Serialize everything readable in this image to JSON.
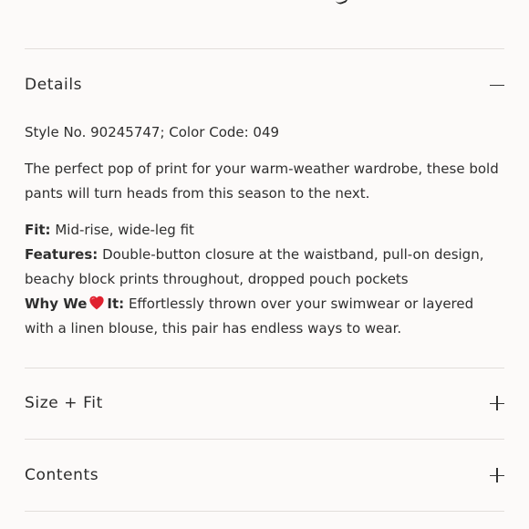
{
  "details": {
    "title": "Details",
    "style_line": "Style No. 90245747; Color Code: 049",
    "description": "The perfect pop of print for your warm-weather wardrobe, these bold pants will turn heads from this season to the next.",
    "fit_label": "Fit:",
    "fit_value": "Mid-rise, wide-leg fit",
    "features_label": "Features:",
    "features_value": "Double-button closure at the waistband, pull-on design, beachy block prints throughout, dropped pouch pockets",
    "why_label_start": "Why We",
    "why_label_end": "It:",
    "why_value": "Effortlessly thrown over your swimwear or layered with a linen blouse, this pair has endless ways to wear.",
    "toggle_icon": "minus-icon"
  },
  "size_fit": {
    "title": "Size + Fit",
    "toggle_icon": "plus-icon"
  },
  "contents": {
    "title": "Contents",
    "toggle_icon": "plus-icon"
  },
  "colors": {
    "background": "#fcfaf9",
    "text": "#2b2b2b",
    "divider": "#e2dedb",
    "heart": "#e0212f"
  }
}
